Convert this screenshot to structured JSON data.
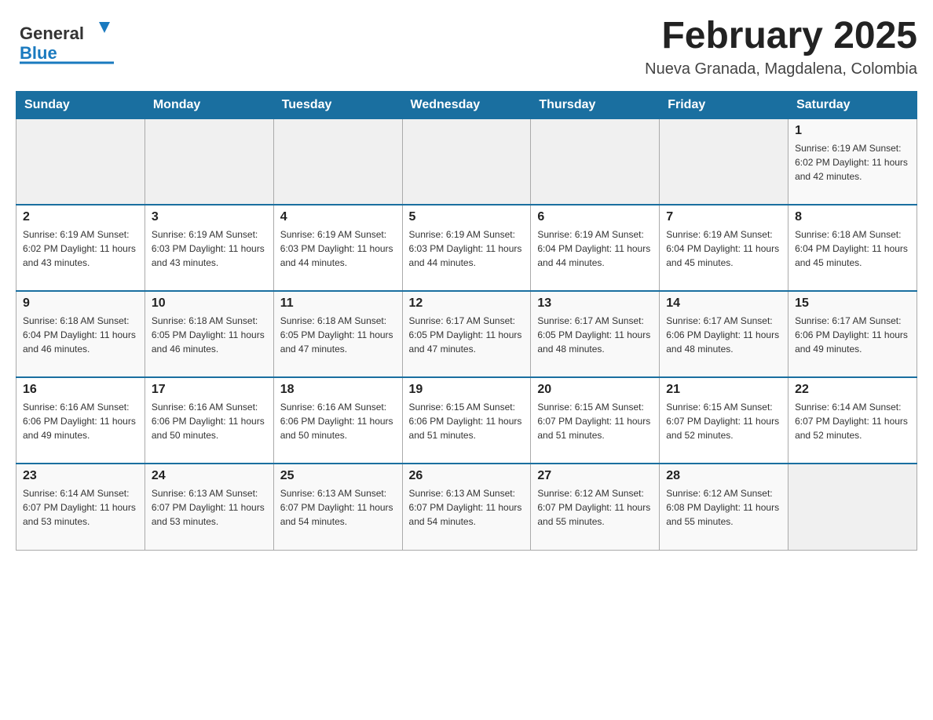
{
  "header": {
    "logo_general": "General",
    "logo_blue": "Blue",
    "month_title": "February 2025",
    "location": "Nueva Granada, Magdalena, Colombia"
  },
  "days_of_week": [
    "Sunday",
    "Monday",
    "Tuesday",
    "Wednesday",
    "Thursday",
    "Friday",
    "Saturday"
  ],
  "weeks": [
    {
      "days": [
        {
          "num": "",
          "info": ""
        },
        {
          "num": "",
          "info": ""
        },
        {
          "num": "",
          "info": ""
        },
        {
          "num": "",
          "info": ""
        },
        {
          "num": "",
          "info": ""
        },
        {
          "num": "",
          "info": ""
        },
        {
          "num": "1",
          "info": "Sunrise: 6:19 AM\nSunset: 6:02 PM\nDaylight: 11 hours\nand 42 minutes."
        }
      ]
    },
    {
      "days": [
        {
          "num": "2",
          "info": "Sunrise: 6:19 AM\nSunset: 6:02 PM\nDaylight: 11 hours\nand 43 minutes."
        },
        {
          "num": "3",
          "info": "Sunrise: 6:19 AM\nSunset: 6:03 PM\nDaylight: 11 hours\nand 43 minutes."
        },
        {
          "num": "4",
          "info": "Sunrise: 6:19 AM\nSunset: 6:03 PM\nDaylight: 11 hours\nand 44 minutes."
        },
        {
          "num": "5",
          "info": "Sunrise: 6:19 AM\nSunset: 6:03 PM\nDaylight: 11 hours\nand 44 minutes."
        },
        {
          "num": "6",
          "info": "Sunrise: 6:19 AM\nSunset: 6:04 PM\nDaylight: 11 hours\nand 44 minutes."
        },
        {
          "num": "7",
          "info": "Sunrise: 6:19 AM\nSunset: 6:04 PM\nDaylight: 11 hours\nand 45 minutes."
        },
        {
          "num": "8",
          "info": "Sunrise: 6:18 AM\nSunset: 6:04 PM\nDaylight: 11 hours\nand 45 minutes."
        }
      ]
    },
    {
      "days": [
        {
          "num": "9",
          "info": "Sunrise: 6:18 AM\nSunset: 6:04 PM\nDaylight: 11 hours\nand 46 minutes."
        },
        {
          "num": "10",
          "info": "Sunrise: 6:18 AM\nSunset: 6:05 PM\nDaylight: 11 hours\nand 46 minutes."
        },
        {
          "num": "11",
          "info": "Sunrise: 6:18 AM\nSunset: 6:05 PM\nDaylight: 11 hours\nand 47 minutes."
        },
        {
          "num": "12",
          "info": "Sunrise: 6:17 AM\nSunset: 6:05 PM\nDaylight: 11 hours\nand 47 minutes."
        },
        {
          "num": "13",
          "info": "Sunrise: 6:17 AM\nSunset: 6:05 PM\nDaylight: 11 hours\nand 48 minutes."
        },
        {
          "num": "14",
          "info": "Sunrise: 6:17 AM\nSunset: 6:06 PM\nDaylight: 11 hours\nand 48 minutes."
        },
        {
          "num": "15",
          "info": "Sunrise: 6:17 AM\nSunset: 6:06 PM\nDaylight: 11 hours\nand 49 minutes."
        }
      ]
    },
    {
      "days": [
        {
          "num": "16",
          "info": "Sunrise: 6:16 AM\nSunset: 6:06 PM\nDaylight: 11 hours\nand 49 minutes."
        },
        {
          "num": "17",
          "info": "Sunrise: 6:16 AM\nSunset: 6:06 PM\nDaylight: 11 hours\nand 50 minutes."
        },
        {
          "num": "18",
          "info": "Sunrise: 6:16 AM\nSunset: 6:06 PM\nDaylight: 11 hours\nand 50 minutes."
        },
        {
          "num": "19",
          "info": "Sunrise: 6:15 AM\nSunset: 6:06 PM\nDaylight: 11 hours\nand 51 minutes."
        },
        {
          "num": "20",
          "info": "Sunrise: 6:15 AM\nSunset: 6:07 PM\nDaylight: 11 hours\nand 51 minutes."
        },
        {
          "num": "21",
          "info": "Sunrise: 6:15 AM\nSunset: 6:07 PM\nDaylight: 11 hours\nand 52 minutes."
        },
        {
          "num": "22",
          "info": "Sunrise: 6:14 AM\nSunset: 6:07 PM\nDaylight: 11 hours\nand 52 minutes."
        }
      ]
    },
    {
      "days": [
        {
          "num": "23",
          "info": "Sunrise: 6:14 AM\nSunset: 6:07 PM\nDaylight: 11 hours\nand 53 minutes."
        },
        {
          "num": "24",
          "info": "Sunrise: 6:13 AM\nSunset: 6:07 PM\nDaylight: 11 hours\nand 53 minutes."
        },
        {
          "num": "25",
          "info": "Sunrise: 6:13 AM\nSunset: 6:07 PM\nDaylight: 11 hours\nand 54 minutes."
        },
        {
          "num": "26",
          "info": "Sunrise: 6:13 AM\nSunset: 6:07 PM\nDaylight: 11 hours\nand 54 minutes."
        },
        {
          "num": "27",
          "info": "Sunrise: 6:12 AM\nSunset: 6:07 PM\nDaylight: 11 hours\nand 55 minutes."
        },
        {
          "num": "28",
          "info": "Sunrise: 6:12 AM\nSunset: 6:08 PM\nDaylight: 11 hours\nand 55 minutes."
        },
        {
          "num": "",
          "info": ""
        }
      ]
    }
  ]
}
